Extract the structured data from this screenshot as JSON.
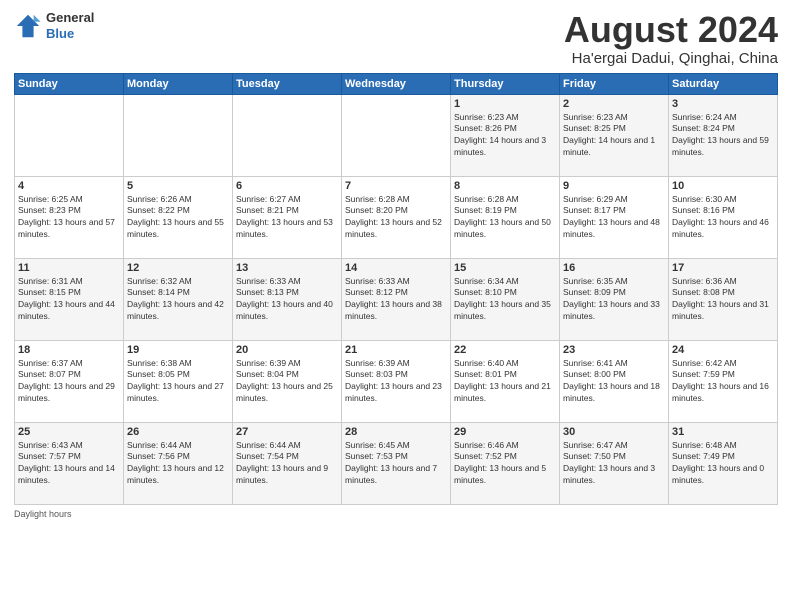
{
  "logo": {
    "general": "General",
    "blue": "Blue"
  },
  "title": "August 2024",
  "subtitle": "Ha'ergai Dadui, Qinghai, China",
  "days_of_week": [
    "Sunday",
    "Monday",
    "Tuesday",
    "Wednesday",
    "Thursday",
    "Friday",
    "Saturday"
  ],
  "weeks": [
    [
      null,
      null,
      null,
      null,
      {
        "day": "1",
        "sunrise": "6:23 AM",
        "sunset": "8:26 PM",
        "daylight": "14 hours and 3 minutes."
      },
      {
        "day": "2",
        "sunrise": "6:23 AM",
        "sunset": "8:25 PM",
        "daylight": "14 hours and 1 minute."
      },
      {
        "day": "3",
        "sunrise": "6:24 AM",
        "sunset": "8:24 PM",
        "daylight": "13 hours and 59 minutes."
      }
    ],
    [
      {
        "day": "4",
        "sunrise": "6:25 AM",
        "sunset": "8:23 PM",
        "daylight": "13 hours and 57 minutes."
      },
      {
        "day": "5",
        "sunrise": "6:26 AM",
        "sunset": "8:22 PM",
        "daylight": "13 hours and 55 minutes."
      },
      {
        "day": "6",
        "sunrise": "6:27 AM",
        "sunset": "8:21 PM",
        "daylight": "13 hours and 53 minutes."
      },
      {
        "day": "7",
        "sunrise": "6:28 AM",
        "sunset": "8:20 PM",
        "daylight": "13 hours and 52 minutes."
      },
      {
        "day": "8",
        "sunrise": "6:28 AM",
        "sunset": "8:19 PM",
        "daylight": "13 hours and 50 minutes."
      },
      {
        "day": "9",
        "sunrise": "6:29 AM",
        "sunset": "8:17 PM",
        "daylight": "13 hours and 48 minutes."
      },
      {
        "day": "10",
        "sunrise": "6:30 AM",
        "sunset": "8:16 PM",
        "daylight": "13 hours and 46 minutes."
      }
    ],
    [
      {
        "day": "11",
        "sunrise": "6:31 AM",
        "sunset": "8:15 PM",
        "daylight": "13 hours and 44 minutes."
      },
      {
        "day": "12",
        "sunrise": "6:32 AM",
        "sunset": "8:14 PM",
        "daylight": "13 hours and 42 minutes."
      },
      {
        "day": "13",
        "sunrise": "6:33 AM",
        "sunset": "8:13 PM",
        "daylight": "13 hours and 40 minutes."
      },
      {
        "day": "14",
        "sunrise": "6:33 AM",
        "sunset": "8:12 PM",
        "daylight": "13 hours and 38 minutes."
      },
      {
        "day": "15",
        "sunrise": "6:34 AM",
        "sunset": "8:10 PM",
        "daylight": "13 hours and 35 minutes."
      },
      {
        "day": "16",
        "sunrise": "6:35 AM",
        "sunset": "8:09 PM",
        "daylight": "13 hours and 33 minutes."
      },
      {
        "day": "17",
        "sunrise": "6:36 AM",
        "sunset": "8:08 PM",
        "daylight": "13 hours and 31 minutes."
      }
    ],
    [
      {
        "day": "18",
        "sunrise": "6:37 AM",
        "sunset": "8:07 PM",
        "daylight": "13 hours and 29 minutes."
      },
      {
        "day": "19",
        "sunrise": "6:38 AM",
        "sunset": "8:05 PM",
        "daylight": "13 hours and 27 minutes."
      },
      {
        "day": "20",
        "sunrise": "6:39 AM",
        "sunset": "8:04 PM",
        "daylight": "13 hours and 25 minutes."
      },
      {
        "day": "21",
        "sunrise": "6:39 AM",
        "sunset": "8:03 PM",
        "daylight": "13 hours and 23 minutes."
      },
      {
        "day": "22",
        "sunrise": "6:40 AM",
        "sunset": "8:01 PM",
        "daylight": "13 hours and 21 minutes."
      },
      {
        "day": "23",
        "sunrise": "6:41 AM",
        "sunset": "8:00 PM",
        "daylight": "13 hours and 18 minutes."
      },
      {
        "day": "24",
        "sunrise": "6:42 AM",
        "sunset": "7:59 PM",
        "daylight": "13 hours and 16 minutes."
      }
    ],
    [
      {
        "day": "25",
        "sunrise": "6:43 AM",
        "sunset": "7:57 PM",
        "daylight": "13 hours and 14 minutes."
      },
      {
        "day": "26",
        "sunrise": "6:44 AM",
        "sunset": "7:56 PM",
        "daylight": "13 hours and 12 minutes."
      },
      {
        "day": "27",
        "sunrise": "6:44 AM",
        "sunset": "7:54 PM",
        "daylight": "13 hours and 9 minutes."
      },
      {
        "day": "28",
        "sunrise": "6:45 AM",
        "sunset": "7:53 PM",
        "daylight": "13 hours and 7 minutes."
      },
      {
        "day": "29",
        "sunrise": "6:46 AM",
        "sunset": "7:52 PM",
        "daylight": "13 hours and 5 minutes."
      },
      {
        "day": "30",
        "sunrise": "6:47 AM",
        "sunset": "7:50 PM",
        "daylight": "13 hours and 3 minutes."
      },
      {
        "day": "31",
        "sunrise": "6:48 AM",
        "sunset": "7:49 PM",
        "daylight": "13 hours and 0 minutes."
      }
    ]
  ],
  "footer": {
    "label": "Daylight hours"
  }
}
